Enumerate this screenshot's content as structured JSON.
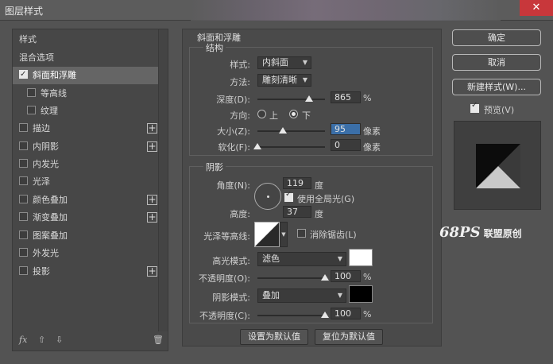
{
  "window": {
    "title": "图层样式",
    "close": "✕"
  },
  "left": {
    "items": [
      {
        "label": "样式",
        "checkbox": false,
        "checked": false,
        "plus": false,
        "indent": false,
        "selected": false
      },
      {
        "label": "混合选项",
        "checkbox": false,
        "checked": false,
        "plus": false,
        "indent": false,
        "selected": false
      },
      {
        "label": "斜面和浮雕",
        "checkbox": true,
        "checked": true,
        "plus": false,
        "indent": false,
        "selected": true
      },
      {
        "label": "等高线",
        "checkbox": true,
        "checked": false,
        "plus": false,
        "indent": true,
        "selected": false
      },
      {
        "label": "纹理",
        "checkbox": true,
        "checked": false,
        "plus": false,
        "indent": true,
        "selected": false
      },
      {
        "label": "描边",
        "checkbox": true,
        "checked": false,
        "plus": true,
        "indent": false,
        "selected": false
      },
      {
        "label": "内阴影",
        "checkbox": true,
        "checked": false,
        "plus": true,
        "indent": false,
        "selected": false
      },
      {
        "label": "内发光",
        "checkbox": true,
        "checked": false,
        "plus": false,
        "indent": false,
        "selected": false
      },
      {
        "label": "光泽",
        "checkbox": true,
        "checked": false,
        "plus": false,
        "indent": false,
        "selected": false
      },
      {
        "label": "颜色叠加",
        "checkbox": true,
        "checked": false,
        "plus": true,
        "indent": false,
        "selected": false
      },
      {
        "label": "渐变叠加",
        "checkbox": true,
        "checked": false,
        "plus": true,
        "indent": false,
        "selected": false
      },
      {
        "label": "图案叠加",
        "checkbox": true,
        "checked": false,
        "plus": false,
        "indent": false,
        "selected": false
      },
      {
        "label": "外发光",
        "checkbox": true,
        "checked": false,
        "plus": false,
        "indent": false,
        "selected": false
      },
      {
        "label": "投影",
        "checkbox": true,
        "checked": false,
        "plus": true,
        "indent": false,
        "selected": false
      }
    ],
    "footer": {
      "fx": "fx",
      "up": "⇧",
      "down": "⇩",
      "trash": "🗑"
    }
  },
  "bevel": {
    "section_title": "斜面和浮雕",
    "structure": {
      "title": "结构",
      "style_label": "样式:",
      "style_value": "内斜面",
      "technique_label": "方法:",
      "technique_value": "雕刻清晰",
      "depth_label": "深度(D):",
      "depth_value": "865",
      "depth_unit": "%",
      "depth_fraction": 0.77,
      "direction_label": "方向:",
      "dir_up": "上",
      "dir_down": "下",
      "direction_selected": "下",
      "size_label": "大小(Z):",
      "size_value": "95",
      "size_unit": "像素",
      "size_fraction": 0.38,
      "soften_label": "软化(F):",
      "soften_value": "0",
      "soften_unit": "像素",
      "soften_fraction": 0.0
    },
    "shading": {
      "title": "阴影",
      "angle_label": "角度(N):",
      "angle_value": "119",
      "angle_unit": "度",
      "global_light_label": "使用全局光(G)",
      "global_light_checked": true,
      "altitude_label": "高度:",
      "altitude_value": "37",
      "altitude_unit": "度",
      "gloss_label": "光泽等高线:",
      "antialias_label": "消除锯齿(L)",
      "antialias_checked": false,
      "highlight_mode_label": "高光模式:",
      "highlight_mode_value": "滤色",
      "highlight_color": "#ffffff",
      "highlight_opacity_label": "不透明度(O):",
      "highlight_opacity_value": "100",
      "highlight_opacity_unit": "%",
      "highlight_opacity_fraction": 1.0,
      "shadow_mode_label": "阴影模式:",
      "shadow_mode_value": "叠加",
      "shadow_color": "#000000",
      "shadow_opacity_label": "不透明度(C):",
      "shadow_opacity_value": "100",
      "shadow_opacity_unit": "%",
      "shadow_opacity_fraction": 1.0
    },
    "make_default": "设置为默认值",
    "reset_default": "复位为默认值"
  },
  "right": {
    "ok": "确定",
    "cancel": "取消",
    "new_style": "新建样式(W)...",
    "preview_label": "预览(V)",
    "preview_checked": true
  },
  "watermark": {
    "logo": "68PS",
    "text": "联盟原创"
  }
}
